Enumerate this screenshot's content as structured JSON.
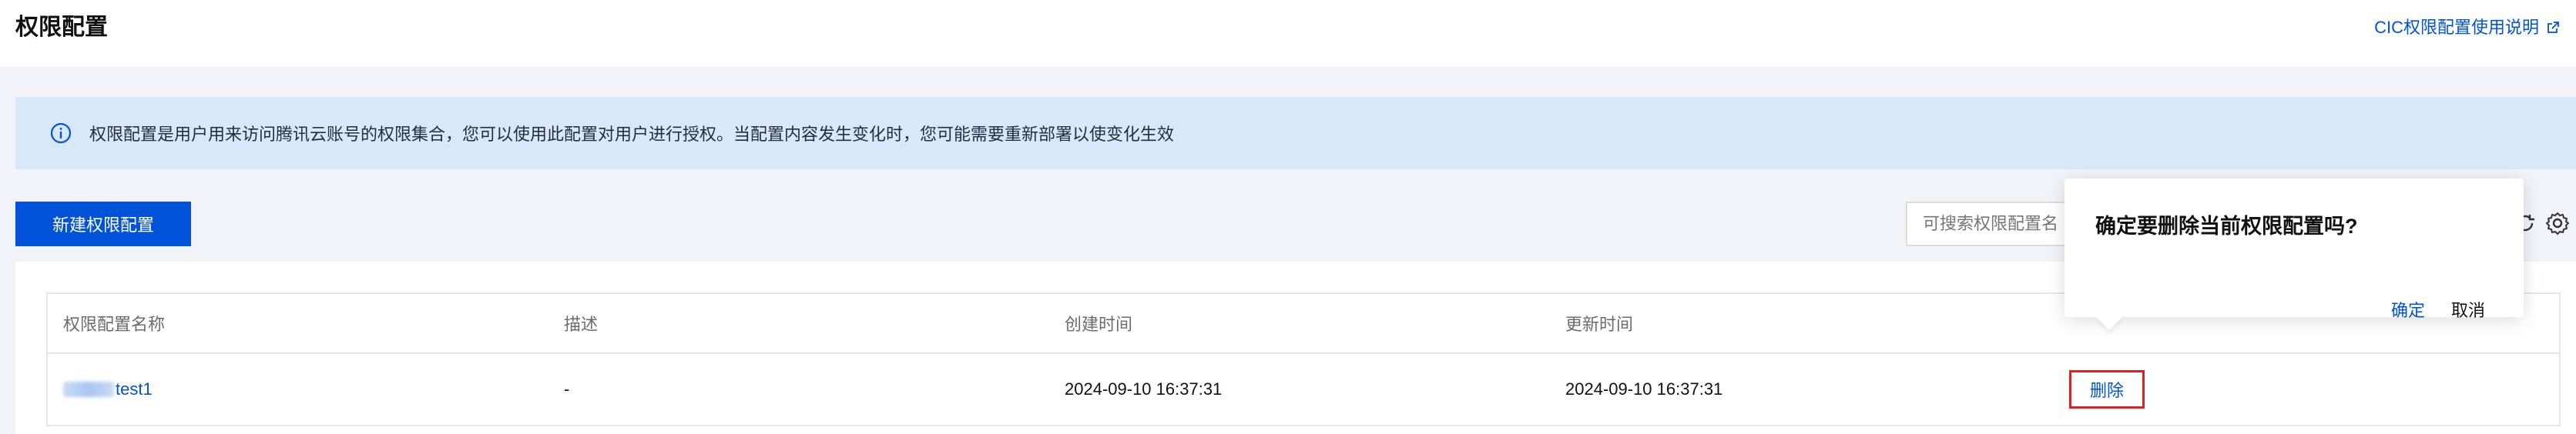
{
  "header": {
    "title": "权限配置",
    "help_link": "CIC权限配置使用说明"
  },
  "notice": {
    "text": "权限配置是用户用来访问腾讯云账号的权限集合，您可以使用此配置对用户进行授权。当配置内容发生变化时，您可能需要重新部署以使变化生效"
  },
  "toolbar": {
    "create_label": "新建权限配置",
    "search_placeholder": "可搜索权限配置名"
  },
  "table": {
    "columns": [
      "权限配置名称",
      "描述",
      "创建时间",
      "更新时间"
    ],
    "rows": [
      {
        "name": "test1",
        "description": "-",
        "created": "2024-09-10 16:37:31",
        "updated": "2024-09-10 16:37:31",
        "action": "删除"
      }
    ]
  },
  "popconfirm": {
    "title": "确定要删除当前权限配置吗?",
    "confirm_label": "确定",
    "cancel_label": "取消"
  },
  "colors": {
    "primary": "#0052d9",
    "notice_bg": "#d9e7fb",
    "highlight_border": "#e02020"
  }
}
